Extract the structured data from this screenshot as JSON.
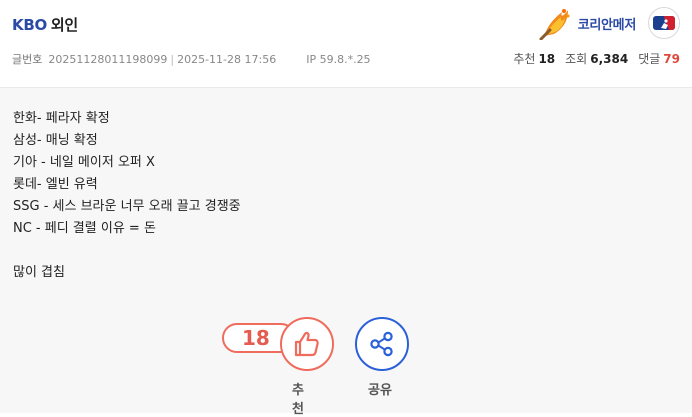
{
  "post": {
    "category": "KBO",
    "title": "외인",
    "author": "코리안메저",
    "meta": {
      "number_label": "글번호",
      "number": "20251128011198099",
      "datetime": "2025-11-28 17:56",
      "ip": "IP 59.8.*.25"
    },
    "stats": {
      "recommend_label": "추천",
      "recommend": "18",
      "views_label": "조회",
      "views": "6,384",
      "comments_label": "댓글",
      "comments": "79"
    },
    "content": [
      "한화- 페라자 확정",
      "삼성- 매닝 확정",
      "기아 - 네일 메이저 오퍼 X",
      "롯데- 엘빈 유력",
      "SSG - 세스 브라운 너무 오래 끌고 경쟁중",
      "NC - 페디 결렬 이유 = 돈",
      "",
      "많이 겹침"
    ]
  },
  "actions": {
    "recommend_count": "18",
    "recommend_label": "추천",
    "share_label": "공유"
  },
  "colors": {
    "accent_blue": "#2b4aa5",
    "recommend_red": "#ef6b5c",
    "share_blue": "#2b60d8",
    "comment_red": "#e0483e"
  },
  "icons": {
    "author_badge": "flame-badge-icon",
    "team_logo": "mlb-logo-icon",
    "recommend": "thumbs-up-icon",
    "share": "share-icon"
  }
}
